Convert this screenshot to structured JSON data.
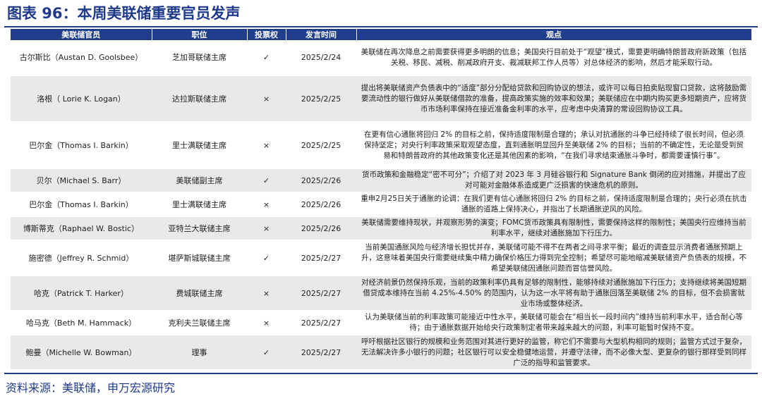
{
  "title": "图表 96：本周美联储重要官员发声",
  "headers": [
    "美联储官员",
    "职位",
    "投票权",
    "发言时间",
    "观点"
  ],
  "rows": [
    {
      "official": "古尔斯比（Austan D. Goolsbee）",
      "position": "芝加哥联储主席",
      "vote": "✓",
      "date": "2025/2/24",
      "view": "美联储在再次降息之前需要获得更多明朗的信息；美国央行目前处于“观望”模式，需要更明确特朗普政府新政策（包括关税、移民、减税、削减政府开支、裁减联邦工作人员等）对总体经济的影响，然后才能采取行动。"
    },
    {
      "official": "洛根（ Lorie K. Logan）",
      "position": "达拉斯联储主席",
      "vote": "×",
      "date": "2025/2/25",
      "view": "提出将美联储资产负债表中的“适度”部分分配给贷款和回购协议的想法，或许可以每日拍卖贴现窗口贷款，这将鼓励需要流动性的银行做好从美联储借款的准备，提高政策实施的效率和效果；美联储应在中期内购买更多短期资产，应将货币市场利率保持在接近准备金利率的水平，应考虑中央清算的常设回购协议工具。"
    },
    {
      "official": "巴尔金（Thomas I. Barkin）",
      "position": "里士满联储主席",
      "vote": "×",
      "date": "2025/2/25",
      "view": "在更有信心通胀将回归 2% 的目标之前，保持适度限制是合理的；承认对抗通胀的斗争已经持续了很长时间，但必须保持坚定；对央行利率政策采取观望态度，直到通胀明显回升至美联储 2% 的目标；当前的不确定性，无论是受到贸易和特朗普政府的其他政策变化还是其他因素的影响，“在我们寻求结束通胀斗争时，都需要谨慎行事”。"
    },
    {
      "official": "贝尔（Michael S. Barr）",
      "position": "美联储副主席",
      "vote": "✓",
      "date": "2025/2/26",
      "view": "货币政策和金融稳定“密不可分”；介绍了对 2023 年 3 月硅谷银行和 Signature Bank 倒闭的应对措施，并提出了应对可能对金融体系造成更广泛损害的快速危机的原则。"
    },
    {
      "official": "巴尔金（Thomas I. Barkin）",
      "position": "里士满联储主席",
      "vote": "×",
      "date": "2025/2/26",
      "view": "重申2月25日关于通胀的论调：在我们更有信心通胀将回归 2% 的目标之前，保持适度限制是合理的；央行必须在抗击通胀的道路上保持决心，并指出了长期通胀逆风的风险。"
    },
    {
      "official": "博斯蒂克（Raphael W. Bostic）",
      "position": "亚特兰大联储主席",
      "vote": "×",
      "date": "2025/2/26",
      "view": "美联储需要维持现状，并观察形势的演变；FOMC货币政策具有限制性，需要保持这样的限制性；美国央行应维持当前利率水平，继续对通胀施加下行压力。"
    },
    {
      "official": "施密德（Jeffrey R. Schmid）",
      "position": "堪萨斯城联储主席",
      "vote": "✓",
      "date": "2025/2/27",
      "view": "当前美国通胀风险与经济增长担忧并存，美联储可能不得不在两者之间寻求平衡；最近的调查显示消费者通胀预期上升，这意味着美国央行需要继续集中精力确保价格压力得到完全控制；希望尽可能地缩减美联储资产负债表的规模，不希望美联储因通胀问题而冒信誉风险。"
    },
    {
      "official": "哈克（Patrick T. Harker）",
      "position": "费城联储主席",
      "vote": "×",
      "date": "2025/2/27",
      "view": "对经济前景仍然保持乐观，当前的政策利率仍具有足够的限制性，能够持续对通胀施加下行压力；支持继续将美国短期借贷成本维持在当前 4.25%-4.50% 的范围内，认为这一水平将有助于通胀回落至美联储 2% 的目标，但不会损害就业市场或整体经济。"
    },
    {
      "official": "哈马克（Beth M. Hammack）",
      "position": "克利夫兰联储主席",
      "vote": "×",
      "date": "2025/2/27",
      "view": "认为美联储当前的利率政策可能接近中性水平，美联储可能会在“相当长一段时间内”维持当前利率水平，适合耐心等待；由于通胀数据开始给央行政策制定者带来越来越大的问题，利率可能暂时保持不变。"
    },
    {
      "official": "鲍曼（Michelle W. Bowman）",
      "position": "理事",
      "vote": "✓",
      "date": "2025/2/27",
      "view": "呼吁根据社区银行的规模和业务范围对其进行更好的监管，称它们不需要与大型机构相同的规则；监管方式过于复杂，无法解决许多小银行的问题；社区银行可以安全稳健地运营，并遵守法律，而不必像大型、更复杂的银行那样受到同样广泛的指导和监管要求。"
    }
  ],
  "source": "资料来源：美联储，申万宏源研究",
  "colors": {
    "accent": "#1f3a8a",
    "header_bg": "#1f3f8c",
    "row_alt": "#e9e9e9"
  }
}
